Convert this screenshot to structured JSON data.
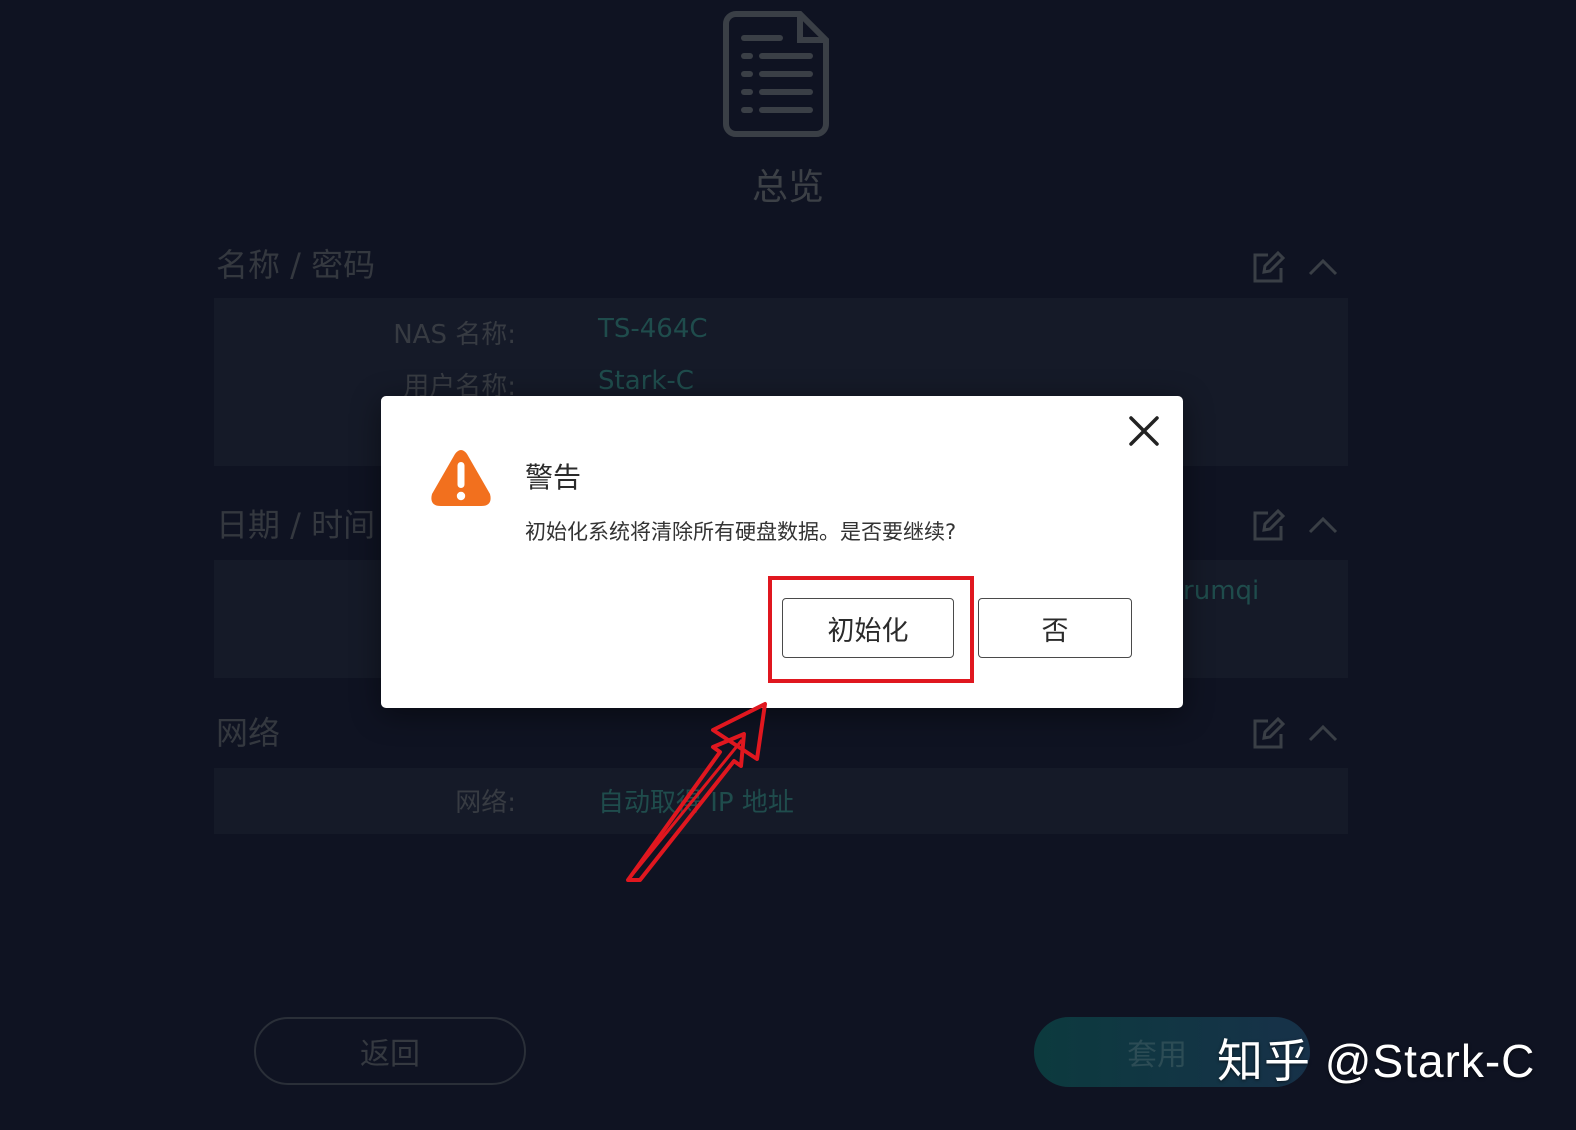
{
  "page": {
    "title": "总览",
    "sections": [
      {
        "title": "名称 / 密码",
        "rows": [
          {
            "label": "NAS 名称:",
            "value": "TS-464C"
          },
          {
            "label": "用户名称:",
            "value": "Stark-C"
          }
        ]
      },
      {
        "title": "日期 / 时间",
        "rows": [
          {
            "label": "",
            "value": "Urumqi"
          }
        ]
      },
      {
        "title": "网络",
        "rows": [
          {
            "label": "网络:",
            "value": "自动取得 IP 地址"
          }
        ]
      }
    ],
    "back_label": "返回",
    "apply_label": "套用"
  },
  "dialog": {
    "title": "警告",
    "message": "初始化系统将清除所有硬盘数据。是否要继续?",
    "confirm_label": "初始化",
    "cancel_label": "否"
  },
  "watermark": "知乎 @Stark-C",
  "colors": {
    "background": "#0f1322",
    "warning": "#f2701e",
    "highlight": "#e0171f",
    "accent_teal": "#1f4c4c"
  }
}
